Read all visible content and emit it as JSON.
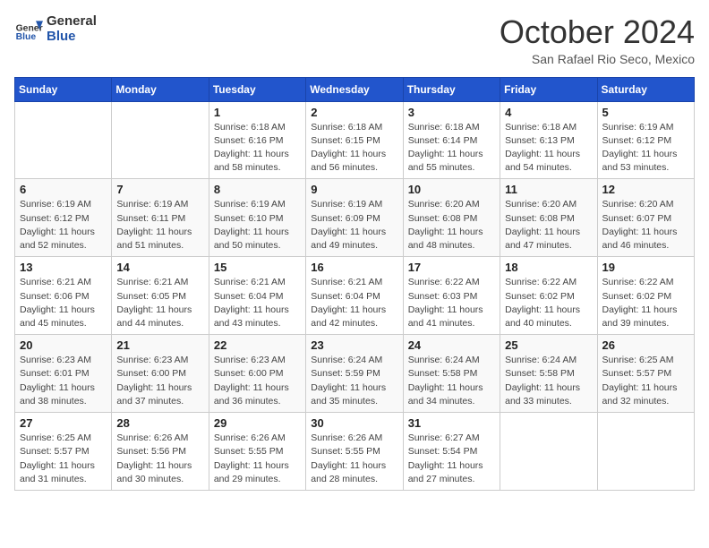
{
  "header": {
    "logo_line1": "General",
    "logo_line2": "Blue",
    "month": "October 2024",
    "location": "San Rafael Rio Seco, Mexico"
  },
  "days_of_week": [
    "Sunday",
    "Monday",
    "Tuesday",
    "Wednesday",
    "Thursday",
    "Friday",
    "Saturday"
  ],
  "weeks": [
    [
      {
        "day": "",
        "info": ""
      },
      {
        "day": "",
        "info": ""
      },
      {
        "day": "1",
        "info": "Sunrise: 6:18 AM\nSunset: 6:16 PM\nDaylight: 11 hours and 58 minutes."
      },
      {
        "day": "2",
        "info": "Sunrise: 6:18 AM\nSunset: 6:15 PM\nDaylight: 11 hours and 56 minutes."
      },
      {
        "day": "3",
        "info": "Sunrise: 6:18 AM\nSunset: 6:14 PM\nDaylight: 11 hours and 55 minutes."
      },
      {
        "day": "4",
        "info": "Sunrise: 6:18 AM\nSunset: 6:13 PM\nDaylight: 11 hours and 54 minutes."
      },
      {
        "day": "5",
        "info": "Sunrise: 6:19 AM\nSunset: 6:12 PM\nDaylight: 11 hours and 53 minutes."
      }
    ],
    [
      {
        "day": "6",
        "info": "Sunrise: 6:19 AM\nSunset: 6:12 PM\nDaylight: 11 hours and 52 minutes."
      },
      {
        "day": "7",
        "info": "Sunrise: 6:19 AM\nSunset: 6:11 PM\nDaylight: 11 hours and 51 minutes."
      },
      {
        "day": "8",
        "info": "Sunrise: 6:19 AM\nSunset: 6:10 PM\nDaylight: 11 hours and 50 minutes."
      },
      {
        "day": "9",
        "info": "Sunrise: 6:19 AM\nSunset: 6:09 PM\nDaylight: 11 hours and 49 minutes."
      },
      {
        "day": "10",
        "info": "Sunrise: 6:20 AM\nSunset: 6:08 PM\nDaylight: 11 hours and 48 minutes."
      },
      {
        "day": "11",
        "info": "Sunrise: 6:20 AM\nSunset: 6:08 PM\nDaylight: 11 hours and 47 minutes."
      },
      {
        "day": "12",
        "info": "Sunrise: 6:20 AM\nSunset: 6:07 PM\nDaylight: 11 hours and 46 minutes."
      }
    ],
    [
      {
        "day": "13",
        "info": "Sunrise: 6:21 AM\nSunset: 6:06 PM\nDaylight: 11 hours and 45 minutes."
      },
      {
        "day": "14",
        "info": "Sunrise: 6:21 AM\nSunset: 6:05 PM\nDaylight: 11 hours and 44 minutes."
      },
      {
        "day": "15",
        "info": "Sunrise: 6:21 AM\nSunset: 6:04 PM\nDaylight: 11 hours and 43 minutes."
      },
      {
        "day": "16",
        "info": "Sunrise: 6:21 AM\nSunset: 6:04 PM\nDaylight: 11 hours and 42 minutes."
      },
      {
        "day": "17",
        "info": "Sunrise: 6:22 AM\nSunset: 6:03 PM\nDaylight: 11 hours and 41 minutes."
      },
      {
        "day": "18",
        "info": "Sunrise: 6:22 AM\nSunset: 6:02 PM\nDaylight: 11 hours and 40 minutes."
      },
      {
        "day": "19",
        "info": "Sunrise: 6:22 AM\nSunset: 6:02 PM\nDaylight: 11 hours and 39 minutes."
      }
    ],
    [
      {
        "day": "20",
        "info": "Sunrise: 6:23 AM\nSunset: 6:01 PM\nDaylight: 11 hours and 38 minutes."
      },
      {
        "day": "21",
        "info": "Sunrise: 6:23 AM\nSunset: 6:00 PM\nDaylight: 11 hours and 37 minutes."
      },
      {
        "day": "22",
        "info": "Sunrise: 6:23 AM\nSunset: 6:00 PM\nDaylight: 11 hours and 36 minutes."
      },
      {
        "day": "23",
        "info": "Sunrise: 6:24 AM\nSunset: 5:59 PM\nDaylight: 11 hours and 35 minutes."
      },
      {
        "day": "24",
        "info": "Sunrise: 6:24 AM\nSunset: 5:58 PM\nDaylight: 11 hours and 34 minutes."
      },
      {
        "day": "25",
        "info": "Sunrise: 6:24 AM\nSunset: 5:58 PM\nDaylight: 11 hours and 33 minutes."
      },
      {
        "day": "26",
        "info": "Sunrise: 6:25 AM\nSunset: 5:57 PM\nDaylight: 11 hours and 32 minutes."
      }
    ],
    [
      {
        "day": "27",
        "info": "Sunrise: 6:25 AM\nSunset: 5:57 PM\nDaylight: 11 hours and 31 minutes."
      },
      {
        "day": "28",
        "info": "Sunrise: 6:26 AM\nSunset: 5:56 PM\nDaylight: 11 hours and 30 minutes."
      },
      {
        "day": "29",
        "info": "Sunrise: 6:26 AM\nSunset: 5:55 PM\nDaylight: 11 hours and 29 minutes."
      },
      {
        "day": "30",
        "info": "Sunrise: 6:26 AM\nSunset: 5:55 PM\nDaylight: 11 hours and 28 minutes."
      },
      {
        "day": "31",
        "info": "Sunrise: 6:27 AM\nSunset: 5:54 PM\nDaylight: 11 hours and 27 minutes."
      },
      {
        "day": "",
        "info": ""
      },
      {
        "day": "",
        "info": ""
      }
    ]
  ]
}
